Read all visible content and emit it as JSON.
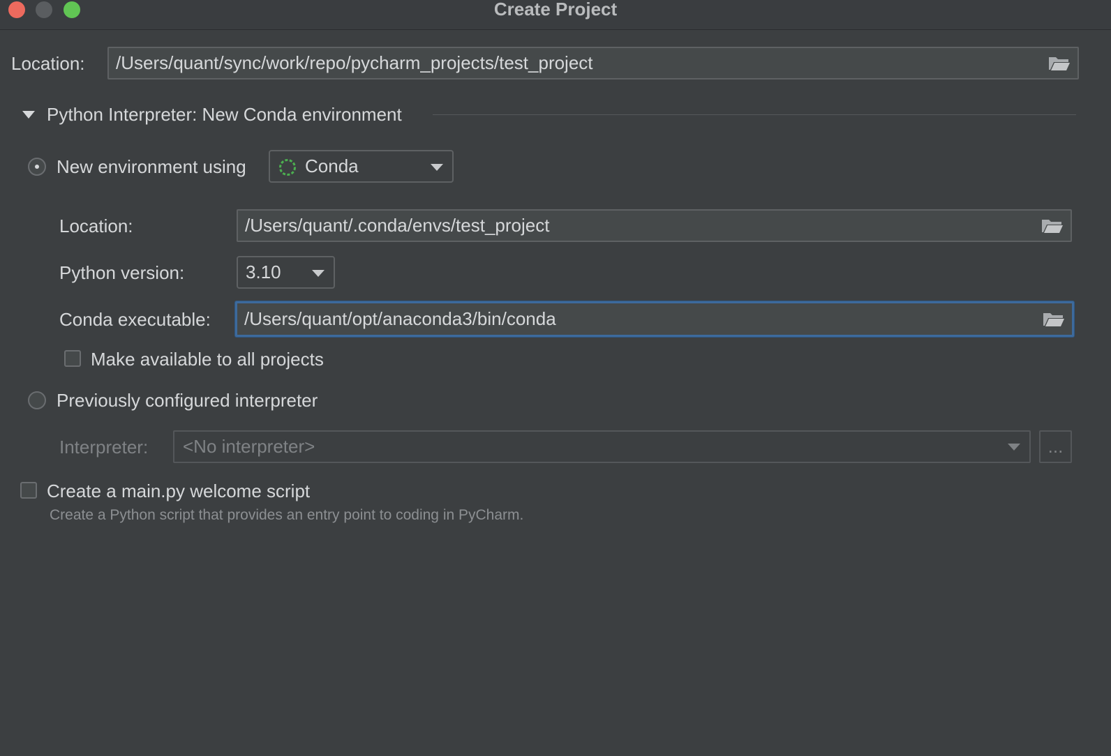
{
  "window": {
    "title": "Create Project"
  },
  "project_location": {
    "label": "Location:",
    "value": "/Users/quant/sync/work/repo/pycharm_projects/test_project"
  },
  "interpreter_section": {
    "title": "Python Interpreter: New Conda environment",
    "expanded": true
  },
  "new_env": {
    "radio_label": "New environment using",
    "selected": true,
    "tool": "Conda",
    "tool_icon": "conda-icon",
    "location_label": "Location:",
    "location_value": "/Users/quant/.conda/envs/test_project",
    "python_version_label": "Python version:",
    "python_version": "3.10",
    "conda_exec_label": "Conda executable:",
    "conda_exec_value": "/Users/quant/opt/anaconda3/bin/conda",
    "make_available_label": "Make available to all projects",
    "make_available_checked": false
  },
  "previous_interpreter": {
    "radio_label": "Previously configured interpreter",
    "selected": false,
    "interpreter_label": "Interpreter:",
    "interpreter_value": "<No interpreter>",
    "browse_label": "..."
  },
  "welcome_script": {
    "label": "Create a main.py welcome script",
    "checked": false,
    "description": "Create a Python script that provides an entry point to coding in PyCharm."
  },
  "colors": {
    "background": "#3c3f41",
    "field": "#45494a",
    "focus_border": "#3d6a9c",
    "conda_green": "#4caf50"
  }
}
